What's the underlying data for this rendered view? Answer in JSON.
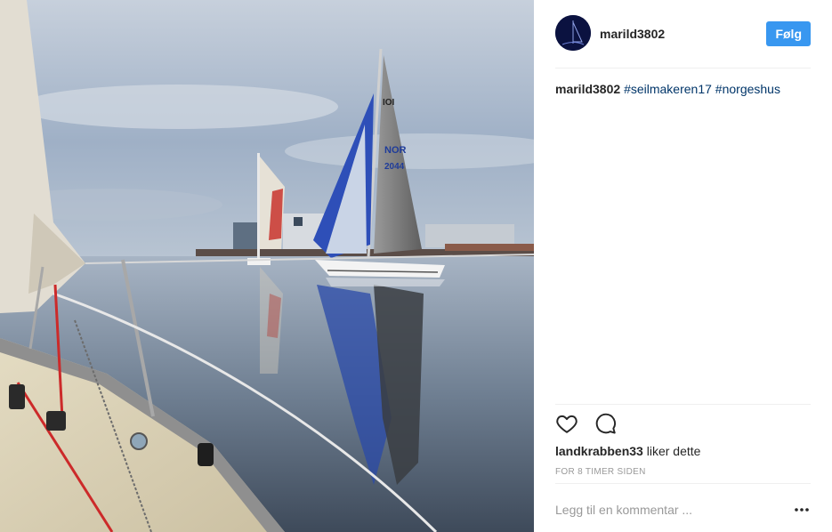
{
  "post": {
    "username": "marild3802",
    "follow_label": "Følg",
    "caption": {
      "user": "marild3802",
      "hashtags": [
        "#seilmakeren17",
        "#norgeshus"
      ]
    },
    "photo": {
      "sail_numbers": [
        "NOR",
        "2044"
      ],
      "class_mark": "IOI"
    }
  },
  "icons": {
    "like": "heart-icon",
    "comment": "comment-icon",
    "more": "more-options-icon"
  },
  "likes": {
    "liker": "landkrabben33",
    "suffix": "liker dette"
  },
  "timestamp": "FOR 8 TIMER SIDEN",
  "comment": {
    "placeholder": "Legg til en kommentar ..."
  },
  "colors": {
    "follow_button": "#3897f0",
    "hashtag": "#003569",
    "muted": "#999999"
  }
}
